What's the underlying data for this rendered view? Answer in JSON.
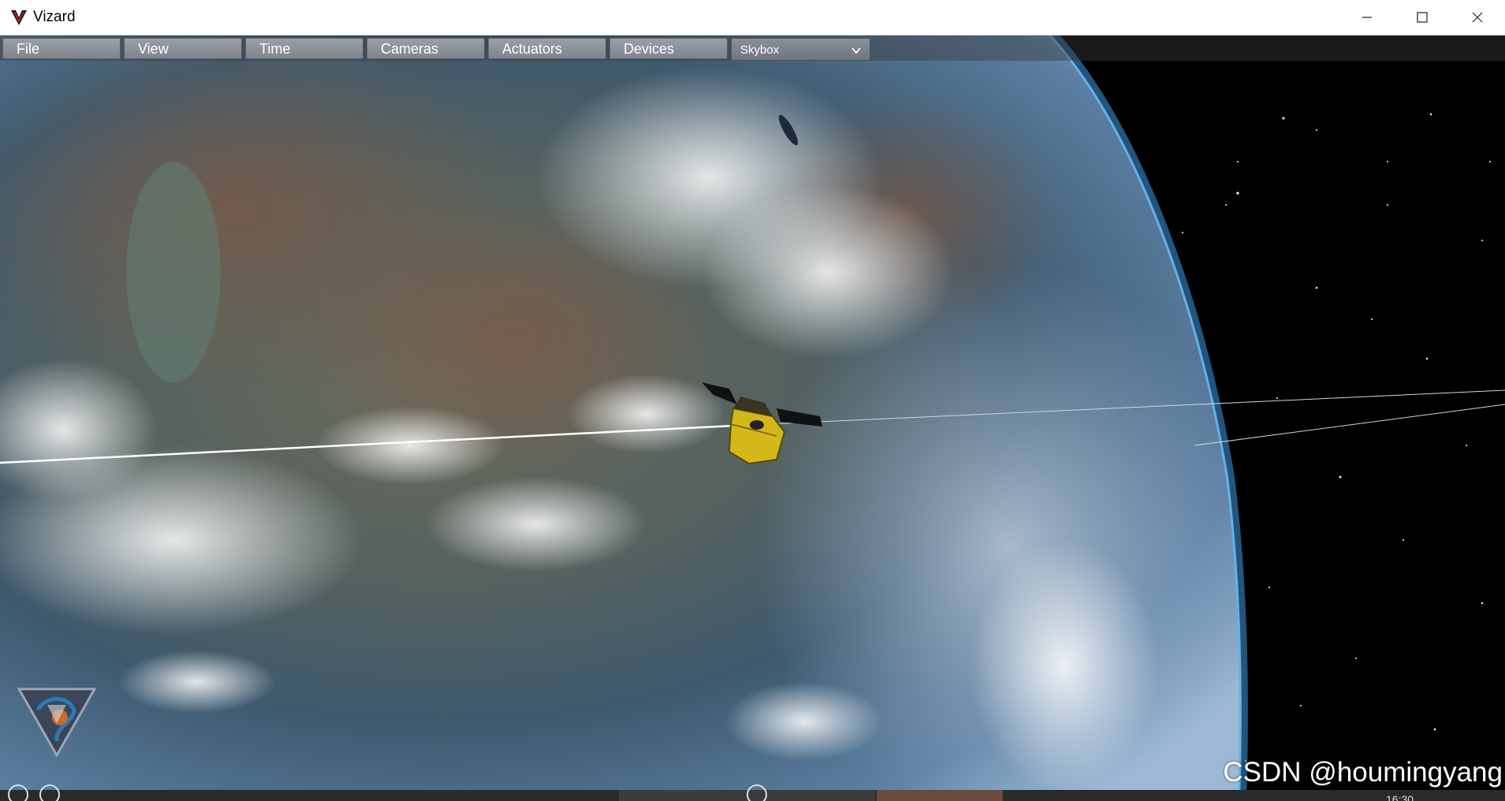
{
  "window": {
    "title": "Vizard"
  },
  "menu": {
    "items": [
      {
        "label": "File"
      },
      {
        "label": "View"
      },
      {
        "label": "Time"
      },
      {
        "label": "Cameras"
      },
      {
        "label": "Actuators"
      },
      {
        "label": "Devices"
      }
    ],
    "skybox_select": {
      "value": "Skybox"
    }
  },
  "watermark": "CSDN @houmingyang",
  "clock": "16:30",
  "colors": {
    "titlebar": "#ffffff",
    "menu_button": "#8c9199",
    "space": "#000000",
    "atmosphere": "#4aa8e8",
    "satellite_body": "#d4b81a"
  },
  "icons": [
    "vizard-logo-icon",
    "minimize-icon",
    "maximize-icon",
    "close-icon",
    "chevron-down-icon",
    "mission-badge-icon"
  ]
}
